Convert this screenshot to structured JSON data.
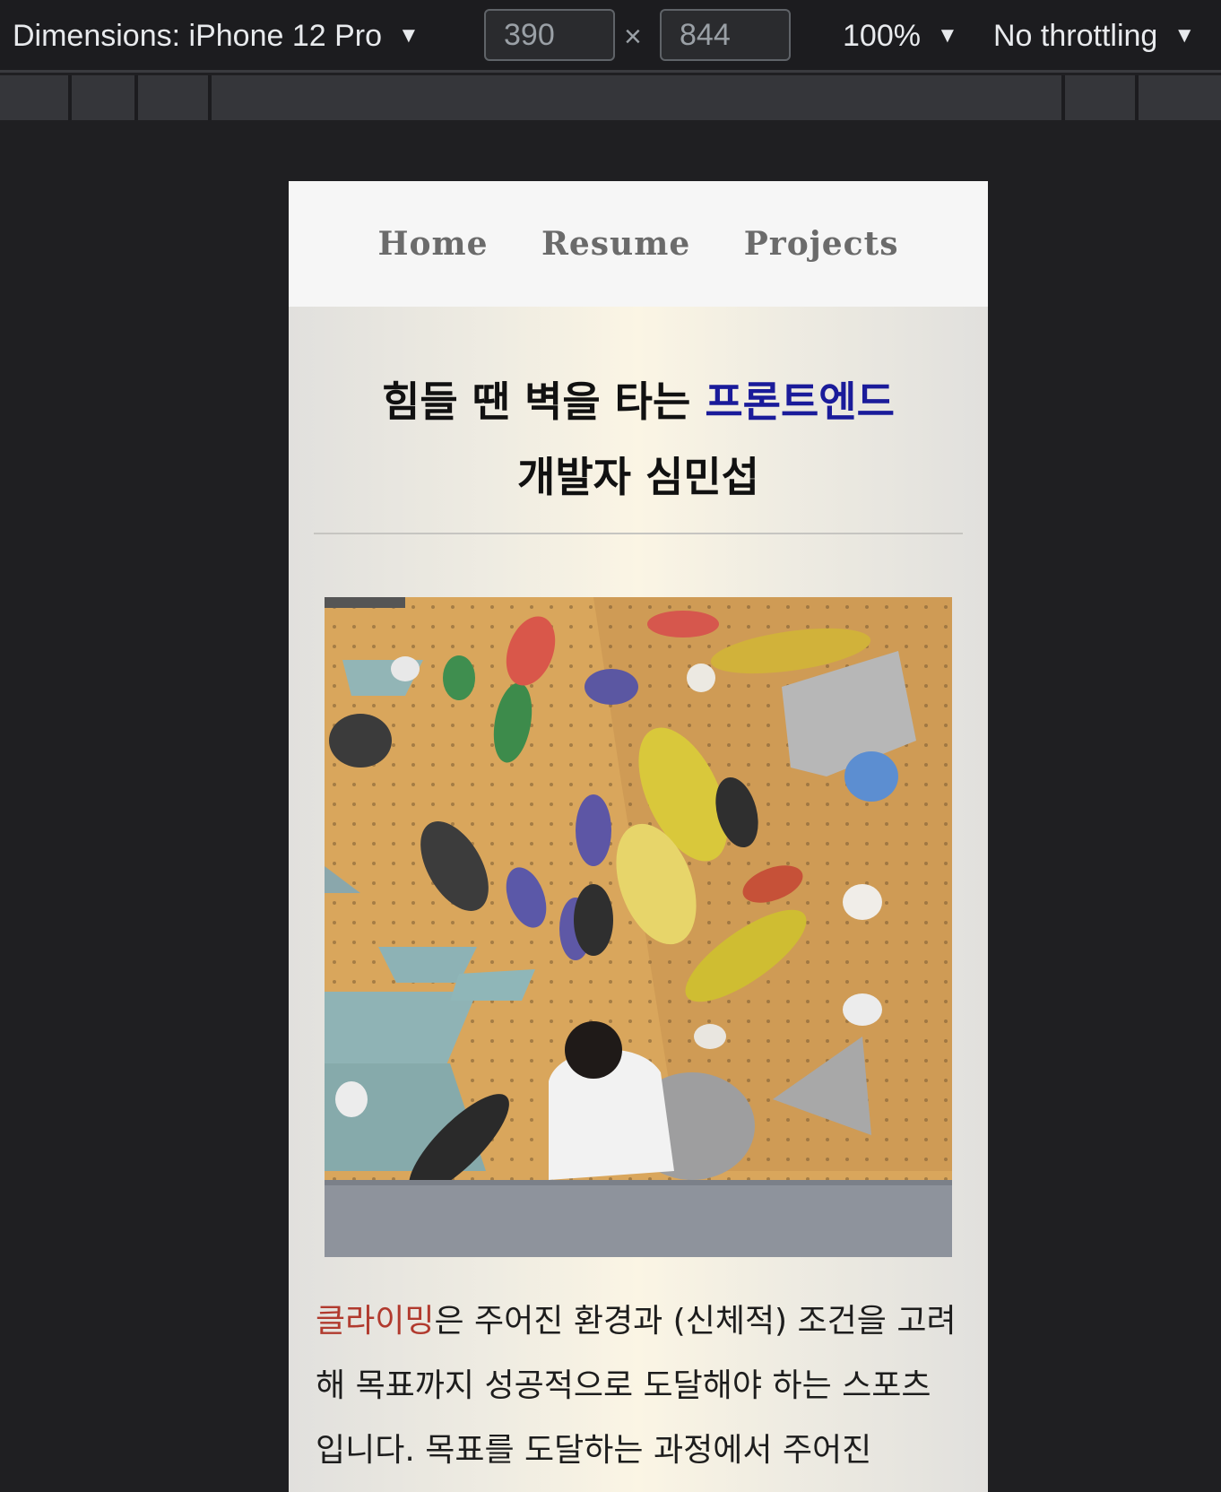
{
  "devtools": {
    "dimensions_label": "Dimensions: iPhone 12 Pro",
    "width_value": "390",
    "times_symbol": "×",
    "height_value": "844",
    "zoom": "100%",
    "throttling": "No throttling",
    "caret": "▼"
  },
  "nav": {
    "items": [
      "Home",
      "Resume",
      "Projects"
    ]
  },
  "hero": {
    "headline_part1": "힘들 땐 벽을 타는 ",
    "headline_accent": "프론트엔드",
    "headline_line2": "개발자 심민섭",
    "accent_color": "#1a1b9a"
  },
  "photo": {
    "kind": "climbing-wall-photo"
  },
  "intro": {
    "highlight": "클라이밍",
    "text": "은 주어진 환경과 (신체적) 조건을 고려해 목표까지 성공적으로 도달해야 하는 스포츠 입니다. 목표를 도달하는 과정에서 주어진",
    "highlight_color": "#b13a2e"
  }
}
